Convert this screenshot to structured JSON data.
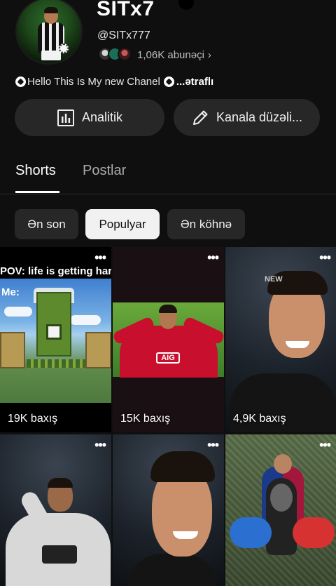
{
  "channel": {
    "name": "SITx7",
    "handle": "@SITx777",
    "subscribers": "1,06K abunəçi",
    "description": "Hello This Is My new Chanel",
    "more_label": "...ətraflı"
  },
  "actions": {
    "analytics_label": "Analitik",
    "edit_label": "Kanala düzəli..."
  },
  "tabs": [
    {
      "label": "Shorts",
      "selected": true
    },
    {
      "label": "Postlar",
      "selected": false
    }
  ],
  "filters": [
    {
      "label": "Ən son",
      "selected": false
    },
    {
      "label": "Populyar",
      "selected": true
    },
    {
      "label": "Ən köhnə",
      "selected": false
    }
  ],
  "shorts": [
    {
      "views": "19K baxış",
      "overlay_line1": "POV: life is getting hard",
      "overlay_line2": "Me:"
    },
    {
      "views": "15K baxış",
      "jersey_text": "AIG"
    },
    {
      "views": "4,9K baxış",
      "watermark": "NEW"
    },
    {
      "views": ""
    },
    {
      "views": ""
    },
    {
      "views": ""
    }
  ],
  "icons": {
    "more": "more-vert-icon",
    "analytics": "bar-chart-icon",
    "edit": "pencil-icon",
    "chevron": "chevron-right-icon"
  },
  "colors": {
    "background": "#0f0f0f",
    "surface": "#272727",
    "chip_selected": "#f1f1f1",
    "text_secondary": "#aaaaaa"
  }
}
